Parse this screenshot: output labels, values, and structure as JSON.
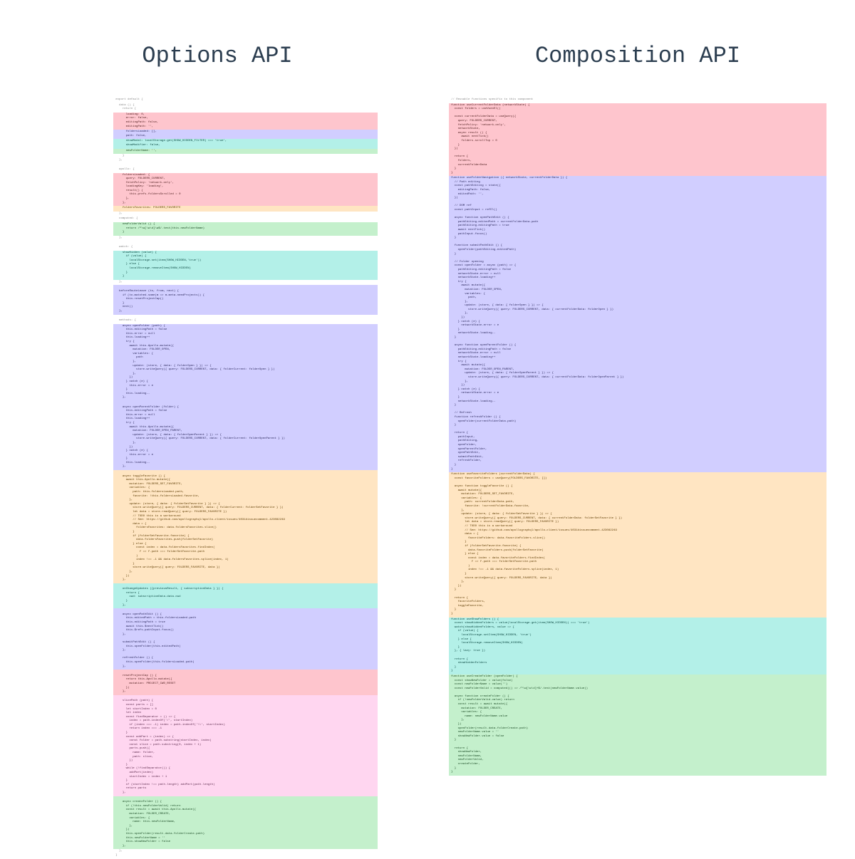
{
  "headings": {
    "left": "Options API",
    "right": "Composition API"
  },
  "options_api_code": {
    "export": "export default {",
    "data_open": "  data () {\n    return {",
    "data_red": "      loading: 0,\n      error: false,\n      editingPath: false,\n      editingPath: '',",
    "data_purple": "      foldersLoaded: [],\n      path: false,",
    "data_teal": "      showModal: localStorage.get(SHOW_HIDDEN_FILTER) === 'true',\n      showModifier: false,",
    "data_green": "      newFolderName: '',",
    "data_close": "    }\n  },",
    "apollo_open": "\n  apollo: {",
    "apollo_red": "    foldersLoaded: {\n      query: FOLDERS_CURRENT,\n      fetchPolicy: 'network-only',\n      loadingKey: 'loading',\n      result() {\n        this.prefs.foldersScrolled = 0\n      },\n    },",
    "apollo_orange": "    foldersFavorites: FOLDERS_FAVORITE",
    "apollo_close": "  },",
    "computed_open": "  computed: {",
    "computed_green": "    newFolderValid () {\n      return /^\\w[\\w\\d]\\w$/.test(this.newFolderName)\n    }",
    "computed_close": "  },",
    "watch_open": "\n  watch: {",
    "watch_teal": "    showHidden (value) {\n      if (value) {\n        localStorage.set(item(SHOW_HIDDEN,'true'))\n      } else {\n        localStorage.removeItem(SHOW_HIDDEN)\n      }\n    }",
    "watch_close": "  },",
    "hook_purple": "\n  beforeRouteLeave (to, from, next) {\n    if (to.matched.some(m => m.meta.needProjects)) {\n      this.resetProjectCap()\n    }\n    next()\n  },",
    "methods_open": "\n  methods: {",
    "methods_purple1": "    async openFolder (path) {\n      this.editingPath = false\n      this.error = null\n      this.loading++\n      try {\n        await this.Apollo.mutate({\n          mutation: FOLDER_OPEN,\n          variables: {\n            path\n          },\n          update: (store, { data: { folderOpen } }) => {\n            store.writeQuery({ query: FOLDERS_CURRENT, data: { folderCurrent: folderOpen } })\n          },\n        })\n      } catch (e) {\n        this.error = e\n      }\n      this.loading--\n    },",
    "methods_purple2": "\n    async openParentFolder (folder) {\n      this.editingPath = false\n      this.error = null\n      this.loading++\n      try {\n        await this.Apollo.mutate({\n          mutation: FOLDER_OPEN_PARENT,\n          update: (store, { data: { folderOpenParent } }) => {\n            store.writeQuery({ query: FOLDERS_CURRENT, data: { folderCurrent: folderOpenParent } })\n          },\n        })\n      } catch (e) {\n        this.error = e\n      }\n      this.loading--\n    },",
    "methods_orange": "\n    async toggleFavorite () {\n      await this.Apollo.mutate({\n        mutation: FOLDERS_SET_FAVORITE,\n        variables: {\n          path: this.foldersLoaded.path,\n          favorite: !this.foldersLoaded.favorite,\n        },\n        update: (store, { data: { folderSetFavorite } }) => {\n          store.writeQuery({ query: FOLDERS_CURRENT, data: { folderCurrent: folderSetFavorite } })\n          let data = store.readQuery({ query: FOLDERS_FAVORITE })\n          // TODO this is a workaround\n          // See: https://github.com/apollographql/apollo-client/issues/4031#issuecomment-423082249\n          data = {\n            foldersFavorites: data.foldersFavorites.slice()\n          }\n          if (folderSetFavorite.favorite) {\n            data.foldersFavorites.push(folderSetFavorite)\n          } else {\n            const index = data.foldersFavorites.findIndex(\n              f => f.path === folderSetFavorite.path\n            )\n            index !== -1 && data.foldersFavorites.splice(index, 1)\n          }\n          store.writeQuery({ query: FOLDERS_FAVORITE, data })\n        },\n      })\n    },",
    "methods_teal": "\n    onChangeUpdates ({previousResult, { subscriptionData } }) {\n      return {\n        cwd: subscriptionData.data.cwd\n      }\n    },",
    "methods_purple3": "\n    async openPathEdit () {\n      this.editedPath = this.foldersLoaded.path\n      this.editingPath = true\n      await this.$nextTick()\n      this.$refs.pathInput.focus()\n    },\n\n    submitPathEdit () {\n      this.openFolder(this.editedPath)\n    },\n\n    refreshFolder () {\n      this.openFolder(this.foldersLoaded.path)\n    },",
    "methods_red": "\n    resetProjectCap () {\n      return this.Apollo.mutate({\n        mutation: PROJECT_CWD_RESET\n      })\n    },",
    "methods_pink": "\n    slicePath (path) {\n      const parts = []\n      let startIndex = 0\n      let index\n      const findSeparator = () => {\n        index = path.indexOf('/', startIndex)\n        if (index === -1) index = path.indexOf('\\\\', startIndex)\n        return index === -1\n      }\n      const addPart = (index) => {\n        const folder = path.substring(startIndex, index)\n        const slice = path.substring(0, index + 1)\n        parts.push({\n          name: folder,\n          path: slice,\n        })\n      }\n      while (!findSeparator()) {\n        addPart(index)\n        startIndex = index + 1\n      }\n      if (startIndex !== path.length) addPart(path.length)\n      return parts\n    },",
    "methods_green": "\n    async createFolder () {\n      if (!this.newFolderValid) return\n      const result = await this.Apollo.mutate({\n        mutation: FOLDER_CREATE,\n        variables: {\n          name: this.newFolderName,\n        },\n      })\n      this.openFolder(result.data.folderCreate.path)\n      this.newFolderName = ''\n      this.showNewFolder = false\n    },",
    "close": "  },\n}"
  },
  "composition_api_code": {
    "comment": "// Reusable functions specific to this component",
    "red_fn": "function useCurrentFolderData (networkState) {\n  const folders = useVuexEl()\n\n  const currentFolderData = useQuery({\n    query: FOLDERS_CURRENT,\n    fetchPolicy: 'network-only',\n    networkState,\n    async result () {\n      await nextTick()\n      folders.scrollTop = 0\n    }\n  })\n\n  return {\n    folders,\n    currentFolderData\n  }\n}",
    "purple_fn": "function useFolderNavigation ({ networkState, currentFolderData }) {\n  // Path editing\n  const pathEditing = state({\n    editingPath: false,\n    editedPath: '',\n  })\n\n  // DOM ref\n  const pathInput = refEl()\n\n  async function openPathEdit () {\n    pathEditing.editedPath = currentFolderData.path\n    pathEditing.editingPath = true\n    await nextTick()\n    pathInput.focus()\n  }\n\n  function submitPathEdit () {\n    openFolder(pathEditing.editedPath)\n  }\n\n  // Folder opening\n  const openFolder = async (path) => {\n    pathEditing.editingPath = false\n    networkState.error = null\n    networkState.loading++\n    try {\n      await mutate({\n        mutation: FOLDER_OPEN,\n        variables: {\n          path,\n        },\n        update: (store, { data: { folderOpen } }) => {\n          store.writeQuery({ query: FOLDERS_CURRENT, data: { currentFolderData: folderOpen } })\n        },\n      })\n    } catch (e) {\n      networkState.error = e\n    }\n    networkState.loading--\n  }\n\n  async function openParentFolder () {\n    pathEditing.editingPath = false\n    networkState.error = null\n    networkState.loading++\n    try {\n      await mutate({\n        mutation: FOLDER_OPEN_PARENT,\n        update: (store, { data: { folderOpenParent } }) => {\n          store.writeQuery({ query: FOLDERS_CURRENT, data: { currentFolderData: folderOpenParent } })\n        },\n      })\n    } catch (e) {\n      networkState.error = e\n    }\n    networkState.loading--\n  }\n\n  // Refresh\n  function refreshFolder () {\n    openFolder(currentFolderData.path)\n  }\n\n  return {\n    pathInput,\n    pathEditing,\n    openFolder,\n    openParentFolder,\n    openPathEdit,\n    submitPathEdit,\n    refreshFolder,\n  }\n}",
    "orange_fn": "function useFavoriteFolders (currentFolderData) {\n  const favoriteFolders = useQuery(FOLDERS_FAVORITE, [])\n\n  async function toggleFavorite () {\n    await mutate({\n      mutation: FOLDERS_SET_FAVORITE,\n      variables: {\n        path: currentFolderData.path,\n        favorite: !currentFolderData.favorite,\n      },\n      update: (store, { data: { folderSetFavorite } }) => {\n        store.writeQuery({ query: FOLDERS_CURRENT, data: { currentFolderData: folderSetFavorite } })\n        let data = store.readQuery({ query: FOLDERS_FAVORITE })\n        // TODO this is a workaround\n        // See: https://github.com/apollographql/apollo-client/issues/4031#issuecomment-423082249\n        data = {\n          favoriteFolders: data.favoriteFolders.slice()\n        }\n        if (folderSetFavorite.favorite) {\n          data.favoriteFolders.push(folderSetFavorite)\n        } else {\n          const index = data.favoriteFolders.findIndex(\n            f => f.path === folderSetFavorite.path\n          )\n          index !== -1 && data.favoriteFolders.splice(index, 1)\n        }\n        store.writeQuery({ query: FOLDERS_FAVORITE, data })\n      },\n    })\n  }\n\n  return {\n    favoriteFolders,\n    toggleFavorite,\n  }\n}",
    "teal_fn": "function useShowFolders () {\n  const showHiddenFolders = value(localStorage.get(item(SHOW_HIDDEN)) === 'true')\n  watch(showHiddenFolders, value => {\n    if (value) {\n      localStorage.setItem(SHOW_HIDDEN, 'true')\n    } else {\n      localStorage.removeItem(SHOW_HIDDEN)\n    }\n  }, { lazy: true })\n\n  return {\n    showHiddenFolders\n  }\n}",
    "green_fn": "function useCreateFolder (openFolder) {\n  const showNewFolder = value(false)\n  const newFolderName = value('')\n  const newFolderValid = computed(() => /^\\w[\\w\\d]+$/.test(newFolderName.value))\n\n  async function createFolder () {\n    if (!newFolderValid.value) return\n    const result = await mutate({\n      mutation: FOLDER_CREATE,\n      variables: {\n        name: newFolderName.value\n      },\n    })\n    openFolder(result.data.folderCreate.path)\n    newFolderName.value = ''\n    showNewFolder.value = false\n  }\n\n  return {\n    showNewFolder,\n    newFolderName,\n    newFolderValid,\n    createFolder,\n  }\n}"
  }
}
